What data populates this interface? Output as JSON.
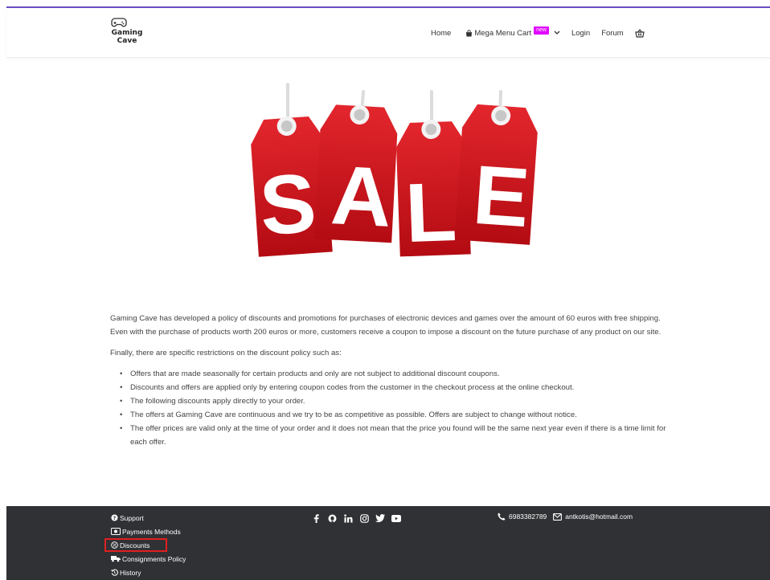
{
  "header": {
    "logo_line1": "Gaming",
    "logo_line2": "Cave",
    "nav": {
      "home": "Home",
      "mega_menu": "Mega Menu Cart",
      "new_badge": "new",
      "login": "Login",
      "forum": "Forum"
    }
  },
  "hero": {
    "letters": [
      "S",
      "A",
      "L",
      "E"
    ]
  },
  "content": {
    "intro": "Gaming Cave has developed a policy of discounts and promotions for purchases of electronic devices and games over the amount of 60 euros with free shipping. Even with the purchase of products worth 200 euros or more, customers receive a coupon to impose a discount on the future purchase of any product on our site.",
    "restrictions_intro": "Finally, there are specific restrictions on the discount policy such as:",
    "bullets": [
      "Offers that are made seasonally for certain products and only are not subject to additional discount coupons.",
      "Discounts and offers are applied only by entering coupon codes from the customer in the checkout process at the online checkout.",
      "The following discounts apply directly to your order.",
      "The offers at Gaming Cave are continuous and we try to be as competitive as possible. Offers are subject to change without notice.",
      "The offer prices are valid only at the time of your order and it does not mean that the price you found will be the same next year even if there is a time limit for each offer."
    ]
  },
  "footer": {
    "links": {
      "support": "Support",
      "payments": "Payments Methods",
      "discounts": "Discounts",
      "consignments": "Consignments Policy",
      "history": "History"
    },
    "contact": {
      "phone": "6983382789",
      "email": "antkotis@hotmail.com"
    }
  },
  "colors": {
    "accent_rule": "#6b4fbf",
    "new_badge": "#e000ff",
    "tag_red": "#d2121b",
    "footer_bg": "#2f3134",
    "highlight": "#e02020"
  }
}
